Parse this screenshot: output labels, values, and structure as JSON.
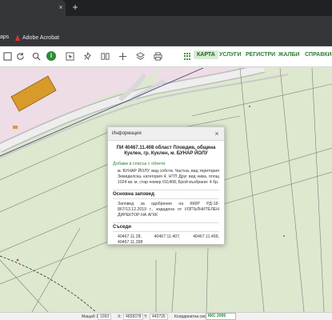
{
  "browser": {
    "tab_close": "×",
    "new_tab": "+",
    "bookmarks": [
      {
        "label": "aps"
      },
      {
        "label": "Adobe Acrobat"
      }
    ]
  },
  "header": {
    "nav": [
      {
        "label": "КАРТА",
        "active": true
      },
      {
        "label": "УСЛУГИ",
        "active": false
      },
      {
        "label": "РЕГИСТРИ",
        "active": false
      },
      {
        "label": "ЖАЛБИ",
        "active": false
      },
      {
        "label": "СПРАВКИ",
        "active": false
      }
    ],
    "info_tool": "i"
  },
  "popup": {
    "title": "Информация",
    "close": "×",
    "property_title": "ПИ 40467.11.408 област Пловдив, община Куклен, гр. Куклен, м. БУНАР ЙОЛУ",
    "add_link": "Добави в списък с обекти",
    "details": "м. БУНАР ЙОЛУ, вид собств. Частна, вид територия Земеделска, категория 4, НТП Друг вид нива, площ 1024 кв. м, стар номер 011408, Брой възбрани: 4 бр.",
    "order_header": "Основна заповед",
    "order_text": "Заповед за одобрение на КККР РД-18-867/13.12.2019 г., издадена от ИЗПЪЛНИТЕЛЕН ДИРЕКТОР НА АГКК",
    "neighbors_header": "Съседи",
    "neighbors_text": "40467.11.28, 40467.11.407, 40467.11.499, 40467.11.398"
  },
  "status": {
    "scale_label": "Мащаб 1:",
    "scale_value": "1093",
    "x_label": "X:",
    "x_value": "4658378",
    "y_label": "Y:",
    "y_value": "443726",
    "coord_label": "Координатна система:",
    "coord_value": "ККС 2005"
  },
  "colors": {
    "accent": "#2e7d32",
    "map_green": "#dce8cf",
    "map_pink": "#eedde6",
    "building": "#d89a2a",
    "boundary": "#7a7a7a"
  }
}
